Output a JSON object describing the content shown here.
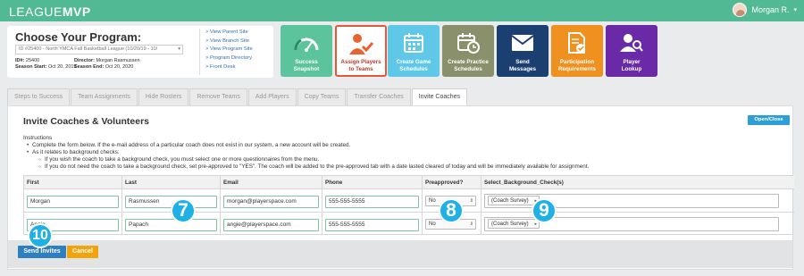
{
  "app": {
    "logo_part1": "LEAGUE",
    "logo_part2": "MVP"
  },
  "user": {
    "name": "Morgan R.",
    "caret": "▾"
  },
  "program": {
    "title": "Choose Your Program:",
    "selected": "ID #25400 - North YMCA Fall Basketball League (10/20/19 - 10/",
    "select_caret": "▾",
    "id_label": "ID#:",
    "id_value": "25400",
    "director_label": "Director:",
    "director_value": "Morgan Rasmussen",
    "season_start_label": "Season Start:",
    "season_start_value": "Oct 20, 2019",
    "season_end_label": "Season End:",
    "season_end_value": "Oct 20, 2020",
    "links": [
      "> View Parent Site",
      "> View Branch Site",
      "> View Program Site",
      "> Program Directory",
      "> Front Desk"
    ]
  },
  "tiles": [
    {
      "line1": "Success",
      "line2": "Snapshot",
      "color": "#5cc49c",
      "icon": "gauge-icon"
    },
    {
      "line1": "Assign Players",
      "line2": "to Teams",
      "color": "#ffffff",
      "icon": "assign-players-icon",
      "active": true
    },
    {
      "line1": "Create Game",
      "line2": "Schedules",
      "color": "#5fc8e8",
      "icon": "calendar-icon"
    },
    {
      "line1": "Create Practice",
      "line2": "Schedules",
      "color": "#8a8f6c",
      "icon": "calendar-clock-icon"
    },
    {
      "line1": "Send",
      "line2": "Messages",
      "color": "#1c3f72",
      "icon": "envelope-icon"
    },
    {
      "line1": "Participation",
      "line2": "Requirements",
      "color": "#f0901e",
      "icon": "document-check-icon"
    },
    {
      "line1": "Player",
      "line2": "Lookup",
      "color": "#6a2aa8",
      "icon": "person-search-icon"
    }
  ],
  "tabs": [
    "Steps to Success",
    "Team Assignments",
    "Hide Rosters",
    "Remove Teams",
    "Add Players",
    "Copy Teams",
    "Transfer Coaches",
    "Invite Coaches"
  ],
  "panel": {
    "title": "Invite Coaches & Volunteers",
    "open_close": "Open/Close",
    "instructions_heading": "Instructions",
    "bullet1": "Complete the form below. If the e-mail address of a particular coach does not exist in our system, a new account will be created.",
    "bullet2": "As it relates to background checks:",
    "sub1": "If you wish the coach to take a background check, you must select one or more questionnaires from the menu.",
    "sub2": "If you do not need the coach to take a background check, set pre-approved to \"YES\". The coach will be added to the pre-approved tab with a date lasted cleared of today and will be immediately available for assignment."
  },
  "table": {
    "headers": [
      "First",
      "Last",
      "Email",
      "Phone",
      "Preapproved?",
      "Select_Background_Check(s)"
    ],
    "rows": [
      {
        "first": "Morgan",
        "last": "Rasmussen",
        "email": "morgan@playerspace.com",
        "phone": "555-555-5555",
        "preapproved": "No",
        "background": "(Coach Survey)"
      },
      {
        "first": "Angie",
        "last": "Papach",
        "email": "angie@playerspace.com",
        "phone": "555-555-5555",
        "preapproved": "No",
        "background": "(Coach Survey)"
      }
    ]
  },
  "footer": {
    "send_label": "Send Invites",
    "cancel_label": "Cancel"
  },
  "callouts": [
    "7",
    "8",
    "9",
    "10"
  ],
  "colors": {
    "brand": "#52b995",
    "callout": "#1fb1e6",
    "send": "#2e7fc1",
    "cancel": "#f0a30a"
  }
}
